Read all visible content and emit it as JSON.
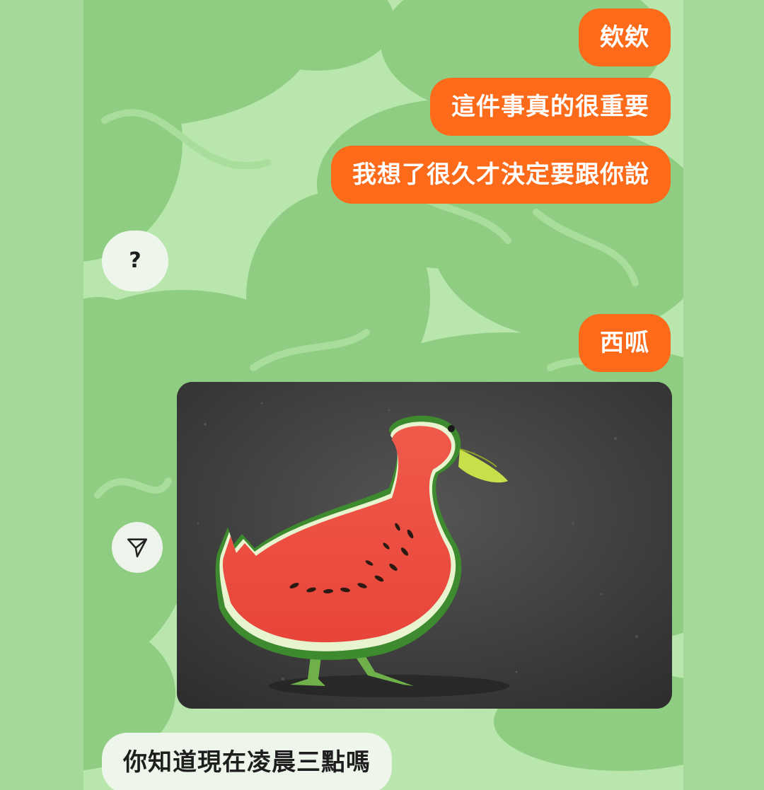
{
  "conversation": {
    "messages": [
      {
        "side": "outgoing",
        "text": "欸欸"
      },
      {
        "side": "outgoing",
        "text": "這件事真的很重要"
      },
      {
        "side": "outgoing",
        "text": "我想了很久才決定要跟你說"
      },
      {
        "side": "incoming",
        "text": "?"
      },
      {
        "side": "outgoing",
        "text": "西呱"
      },
      {
        "side": "outgoing",
        "type": "image",
        "content": "watermelon duck"
      },
      {
        "side": "incoming",
        "text": "你知道現在凌晨三點嗎"
      }
    ]
  },
  "icons": {
    "share": "share-icon"
  },
  "colors": {
    "outgoing_bubble": "#fd6a19",
    "incoming_bubble": "#eef6eb",
    "wallpaper": "#b8e6ad",
    "wallpaper_blobs": "#8fce82",
    "outer_background": "#a4d99a"
  }
}
